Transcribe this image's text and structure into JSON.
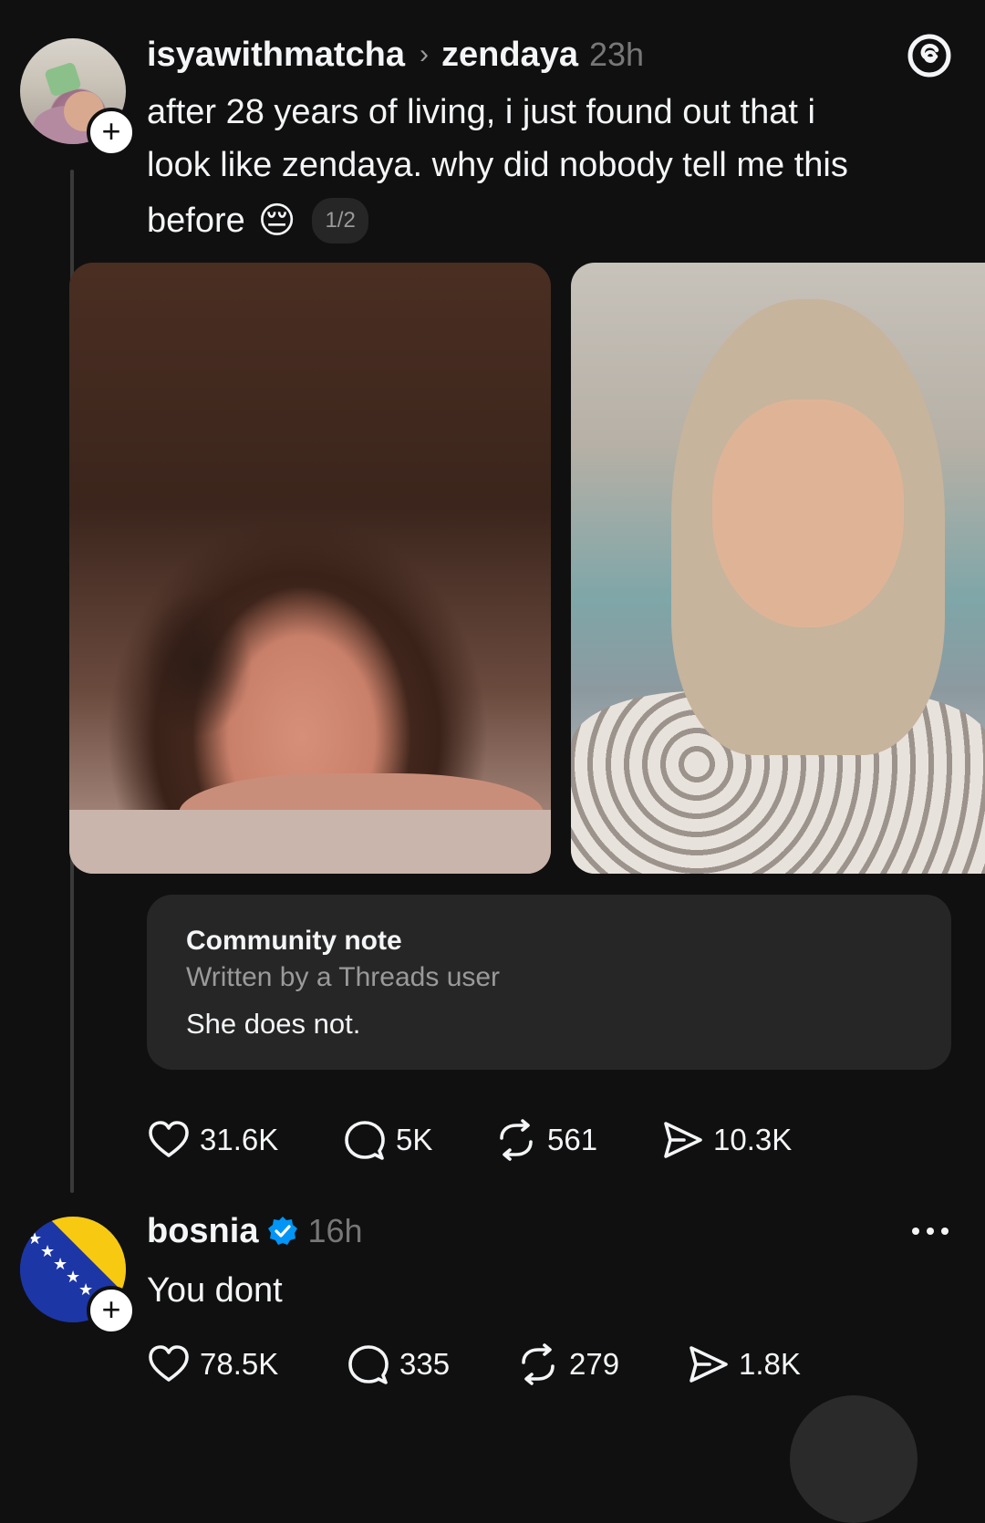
{
  "post": {
    "username": "isyawithmatcha",
    "reply_target": "zendaya",
    "time": "23h",
    "text_line1": "after 28 years of living, i just found out that i",
    "text_line2": "look like zendaya. why did nobody tell me this",
    "text_line3": "before",
    "emoji": "😔",
    "page_indicator": "1/2",
    "images": [
      {
        "name": "zendaya-portrait"
      },
      {
        "name": "user-selfie"
      }
    ],
    "community_note": {
      "title": "Community note",
      "subtitle": "Written by a Threads user",
      "body": "She does not."
    },
    "actions": {
      "likes": "31.6K",
      "replies": "5K",
      "reposts": "561",
      "shares": "10.3K"
    }
  },
  "reply": {
    "username": "bosnia",
    "time": "16h",
    "text": "You dont",
    "actions": {
      "likes": "78.5K",
      "replies": "335",
      "reposts": "279",
      "shares": "1.8K"
    }
  },
  "icons": {
    "logo": "threads-logo-icon",
    "verified": "verified-badge-icon",
    "like": "heart-icon",
    "reply": "comment-icon",
    "repost": "repost-icon",
    "share": "send-icon",
    "more": "more-dots-icon"
  },
  "colors": {
    "background": "#101010",
    "text": "#f3f5f7",
    "muted": "#777777",
    "note_bg": "#262626",
    "verified": "#0095f6",
    "flag_blue": "#1c36a6",
    "flag_yellow": "#f7c911"
  }
}
